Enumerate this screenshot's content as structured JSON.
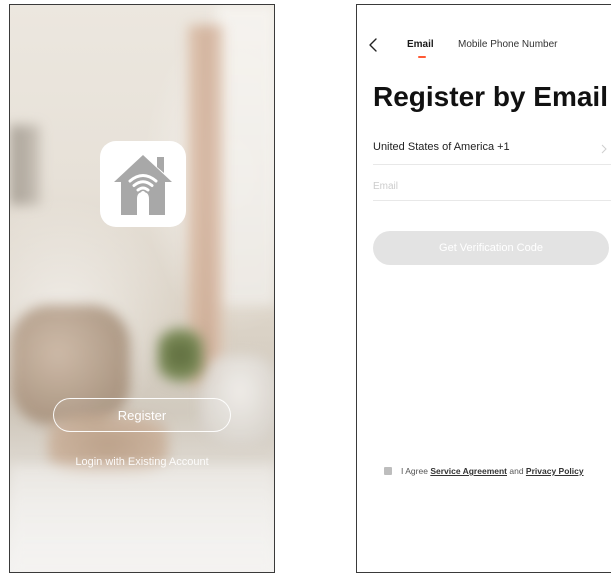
{
  "welcome_screen": {
    "register_label": "Register",
    "login_label": "Login with Existing Account",
    "app_icon": "wifi-house-icon"
  },
  "register_screen": {
    "tabs": [
      {
        "label": "Email",
        "active": true
      },
      {
        "label": "Mobile Phone Number",
        "active": false
      }
    ],
    "title": "Register by Email",
    "country": "United States of America +1",
    "email_placeholder": "Email",
    "email_value": "",
    "verify_button": "Get Verification Code",
    "agreement": {
      "prefix": "I Agree ",
      "service_link": "Service Agreement",
      "and": " and ",
      "privacy_link": "Privacy Policy"
    }
  },
  "colors": {
    "accent": "#ff5a35",
    "button_disabled": "#e3e3e3",
    "icon_gray": "#a8a8a8"
  }
}
